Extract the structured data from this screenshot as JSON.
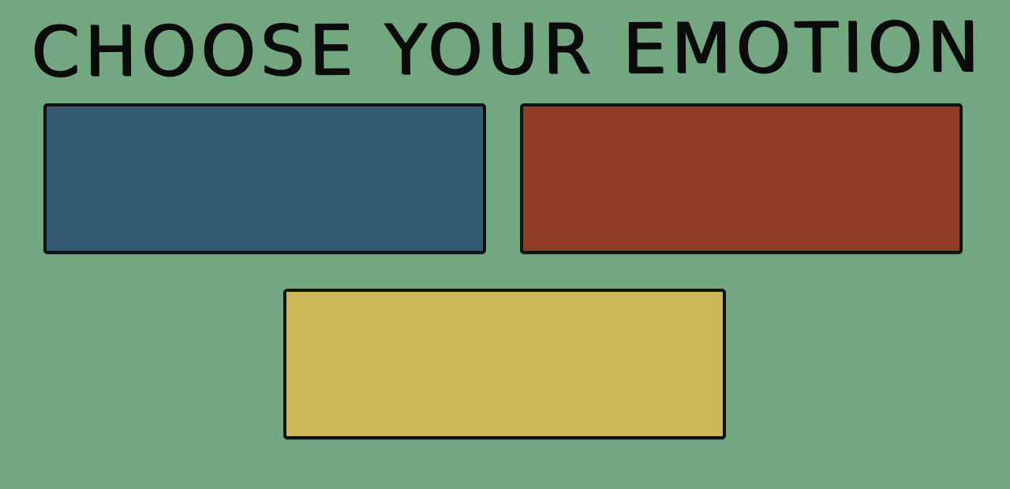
{
  "screen": {
    "title": "CHOOSE YOUR EMOTION",
    "background_color": "#72a780"
  },
  "buttons": [
    {
      "id": "blue",
      "label": "",
      "color": "#325a72"
    },
    {
      "id": "red",
      "label": "",
      "color": "#8e3c27"
    },
    {
      "id": "yellow",
      "label": "",
      "color": "#cbb757"
    }
  ]
}
